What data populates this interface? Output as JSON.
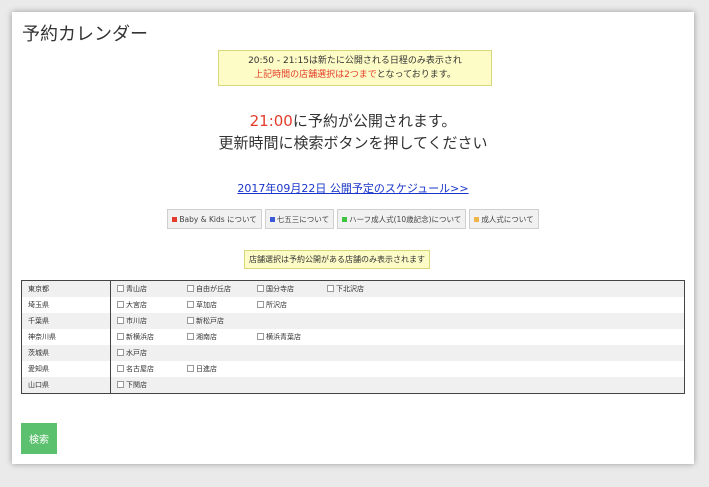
{
  "title": "予約カレンダー",
  "notice": {
    "line1": "20:50 - 21:15は新たに公開される日程のみ表示され",
    "line2_red": "上記時間の店舗選択は2つまで",
    "line2_rest": "となっております。"
  },
  "announce": {
    "time": "21:00",
    "line1_rest": "に予約が公開されます。",
    "line2": "更新時間に検索ボタンを押してください"
  },
  "schedule_link": "2017年09月22日 公開予定のスケジュール>>",
  "tags": [
    {
      "label": "Baby & Kids について",
      "color": "#e53b2b"
    },
    {
      "label": "七五三について",
      "color": "#3b5bd6"
    },
    {
      "label": "ハーフ成人式(10歳記念)について",
      "color": "#3ec43e"
    },
    {
      "label": "成人式について",
      "color": "#f0b54a"
    }
  ],
  "store_note": "店舗選択は予約公開がある店舗のみ表示されます",
  "regions": [
    {
      "pref": "東京都",
      "stores": [
        "青山店",
        "自由が丘店",
        "国分寺店",
        "下北沢店"
      ]
    },
    {
      "pref": "埼玉県",
      "stores": [
        "大宮店",
        "草加店",
        "所沢店"
      ]
    },
    {
      "pref": "千葉県",
      "stores": [
        "市川店",
        "新松戸店"
      ]
    },
    {
      "pref": "神奈川県",
      "stores": [
        "新横浜店",
        "湘南店",
        "横浜青葉店"
      ]
    },
    {
      "pref": "茨城県",
      "stores": [
        "水戸店"
      ]
    },
    {
      "pref": "愛知県",
      "stores": [
        "名古屋店",
        "日進店"
      ]
    },
    {
      "pref": "山口県",
      "stores": [
        "下関店"
      ]
    }
  ],
  "search_button": "検索"
}
